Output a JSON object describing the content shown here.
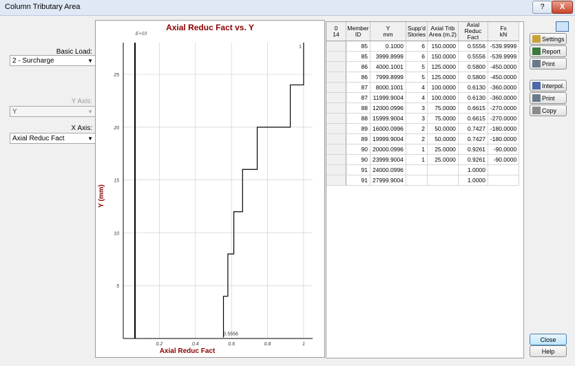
{
  "window": {
    "title": "Column Tributary Area",
    "help_glyph": "?",
    "close_glyph": "X"
  },
  "left_panel": {
    "basic_load_label": "Basic Load:",
    "basic_load_value": "2 - Surcharge",
    "y_axis_label": "Y Axis:",
    "y_axis_value": "Y",
    "x_axis_label": "X Axis:",
    "x_axis_value": "Axial Reduc Fact"
  },
  "chart_data": {
    "type": "line",
    "title": "Axial Reduc Fact vs. Y",
    "xlabel": "Axial Reduc Fact",
    "ylabel": "Y (mm)",
    "y_exponent_label": "E+03",
    "xlim": [
      0,
      1.05
    ],
    "ylim": [
      0,
      28
    ],
    "x_ticks": [
      "0.2",
      "0.4",
      "0.6",
      "0.8",
      "1"
    ],
    "x_tick_values": [
      0.2,
      0.4,
      0.6,
      0.8,
      1.0
    ],
    "y_ticks": [
      "5",
      "10",
      "15",
      "20",
      "25"
    ],
    "y_tick_values": [
      5,
      10,
      15,
      20,
      25
    ],
    "grid": true,
    "vertical_line_x": 0.065,
    "series": [
      {
        "x": [
          0.5556,
          0.5556,
          0.58,
          0.58,
          0.613,
          0.613,
          0.6615,
          0.6615,
          0.7427,
          0.7427,
          0.9261,
          0.9261,
          1.0,
          1.0
        ],
        "y": [
          0.1,
          4.0,
          4.0,
          8.0,
          8.0,
          12.0,
          12.0,
          16.0,
          16.0,
          20.0,
          20.0,
          24.0,
          24.0,
          28.0
        ]
      }
    ],
    "annotations": [
      {
        "text": "0.5556",
        "x": 0.5556,
        "y": 0.1
      },
      {
        "text": "1",
        "x": 1.0,
        "y": 28.0
      }
    ]
  },
  "grid": {
    "corner_line1": "0",
    "corner_line2": "14",
    "headers": [
      [
        "Member",
        "ID"
      ],
      [
        "Y",
        "mm"
      ],
      [
        "Supp'd",
        "Stories"
      ],
      [
        "Axial Trib",
        "Area (m.2)"
      ],
      [
        "Axial",
        "Reduc Fact"
      ],
      [
        "Fx",
        "kN"
      ]
    ],
    "rows": [
      [
        "85",
        "0.1000",
        "6",
        "150.0000",
        "0.5556",
        "-539.9999"
      ],
      [
        "85",
        "3999.8999",
        "6",
        "150.0000",
        "0.5556",
        "-539.9999"
      ],
      [
        "86",
        "4000.1001",
        "5",
        "125.0000",
        "0.5800",
        "-450.0000"
      ],
      [
        "86",
        "7999.8999",
        "5",
        "125.0000",
        "0.5800",
        "-450.0000"
      ],
      [
        "87",
        "8000.1001",
        "4",
        "100.0000",
        "0.6130",
        "-360.0000"
      ],
      [
        "87",
        "11999.9004",
        "4",
        "100.0000",
        "0.6130",
        "-360.0000"
      ],
      [
        "88",
        "12000.0996",
        "3",
        "75.0000",
        "0.6615",
        "-270.0000"
      ],
      [
        "88",
        "15999.9004",
        "3",
        "75.0000",
        "0.6615",
        "-270.0000"
      ],
      [
        "89",
        "16000.0996",
        "2",
        "50.0000",
        "0.7427",
        "-180.0000"
      ],
      [
        "89",
        "19999.9004",
        "2",
        "50.0000",
        "0.7427",
        "-180.0000"
      ],
      [
        "90",
        "20000.0996",
        "1",
        "25.0000",
        "0.9261",
        "-90.0000"
      ],
      [
        "90",
        "23999.9004",
        "1",
        "25.0000",
        "0.9261",
        "-90.0000"
      ],
      [
        "91",
        "24000.0996",
        "",
        "",
        "1.0000",
        ""
      ],
      [
        "91",
        "27999.9004",
        "",
        "",
        "1.0000",
        ""
      ]
    ]
  },
  "buttons": {
    "settings": "Settings",
    "report": "Report",
    "print1": "Print",
    "interpol": "Interpol.",
    "print2": "Print",
    "copy": "Copy",
    "close": "Close",
    "help": "Help"
  },
  "colors": {
    "title_red": "#8b0000",
    "grid_line": "#d0d0d0"
  }
}
